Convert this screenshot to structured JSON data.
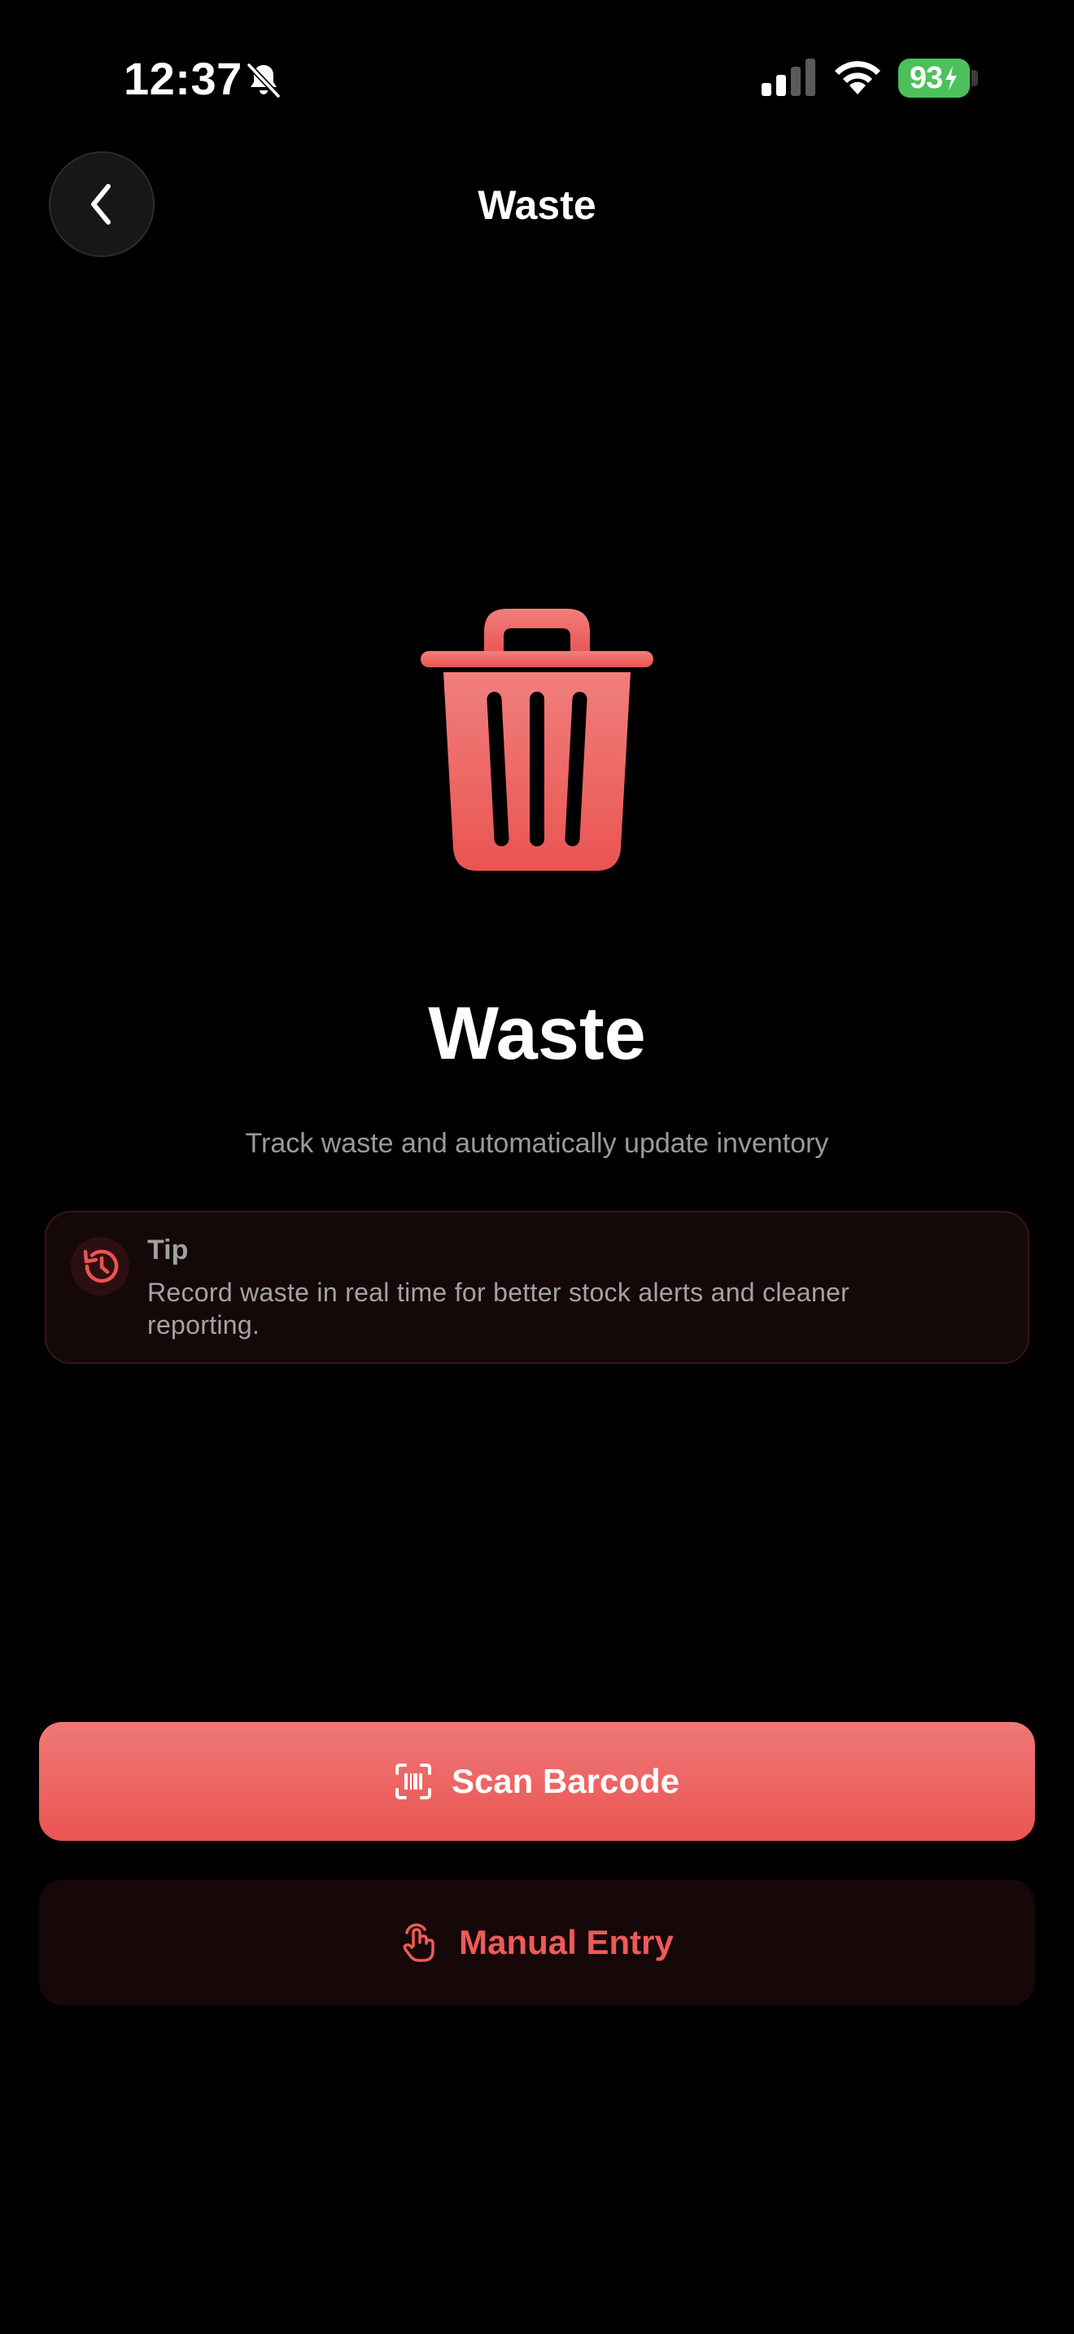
{
  "status_bar": {
    "time": "12:37",
    "battery_level": "93",
    "icons": [
      "bell-slash-icon",
      "cellular-signal-icon",
      "wifi-icon",
      "battery-charging-icon"
    ]
  },
  "nav": {
    "title": "Waste",
    "back_icon": "chevron-left-icon"
  },
  "hero": {
    "icon": "trash-icon",
    "title": "Waste",
    "subtitle": "Track waste and automatically update inventory"
  },
  "tip": {
    "icon": "clock-history-icon",
    "label": "Tip",
    "text": "Record waste in real time for better stock alerts and cleaner reporting."
  },
  "actions": {
    "scan_label": "Scan Barcode",
    "scan_icon": "barcode-scan-icon",
    "manual_label": "Manual Entry",
    "manual_icon": "hand-tap-icon"
  },
  "colors": {
    "accent": "#EA5452",
    "accent_light": "#EF7877",
    "battery": "#4CC05A",
    "background": "#000000"
  }
}
